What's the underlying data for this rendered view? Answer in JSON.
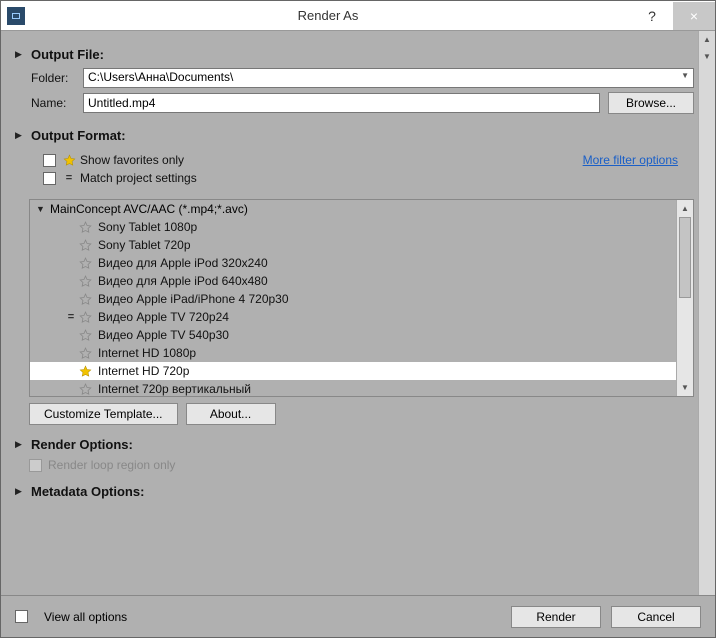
{
  "titlebar": {
    "title": "Render As",
    "help": "?",
    "close": "×"
  },
  "sections": {
    "output_file": "Output File:",
    "output_format": "Output Format:",
    "render_options": "Render Options:",
    "metadata_options": "Metadata Options:"
  },
  "labels": {
    "folder": "Folder:",
    "name": "Name:",
    "browse": "Browse...",
    "show_favorites": "Show favorites only",
    "match_project": "Match project settings",
    "more_filter": "More filter options",
    "customize": "Customize Template...",
    "about": "About...",
    "render_loop": "Render loop region only",
    "view_all": "View all options",
    "render": "Render",
    "cancel": "Cancel"
  },
  "values": {
    "folder": "C:\\Users\\Анна\\Documents\\",
    "name": "Untitled.mp4"
  },
  "format_group": "MainConcept AVC/AAC (*.mp4;*.avc)",
  "formats": [
    {
      "name": "Sony Tablet 1080p",
      "fav": false,
      "eq": false,
      "sel": false
    },
    {
      "name": "Sony Tablet 720p",
      "fav": false,
      "eq": false,
      "sel": false
    },
    {
      "name": "Видео для Apple iPod 320x240",
      "fav": false,
      "eq": false,
      "sel": false
    },
    {
      "name": "Видео для Apple iPod 640x480",
      "fav": false,
      "eq": false,
      "sel": false
    },
    {
      "name": "Видео Apple iPad/iPhone 4 720p30",
      "fav": false,
      "eq": false,
      "sel": false
    },
    {
      "name": "Видео Apple TV 720p24",
      "fav": false,
      "eq": true,
      "sel": false
    },
    {
      "name": "Видео Apple TV 540p30",
      "fav": false,
      "eq": false,
      "sel": false
    },
    {
      "name": "Internet HD 1080p",
      "fav": false,
      "eq": false,
      "sel": false
    },
    {
      "name": "Internet HD 720p",
      "fav": true,
      "eq": false,
      "sel": true
    },
    {
      "name": "Internet 720р вертикальный",
      "fav": false,
      "eq": false,
      "sel": false
    }
  ],
  "colors": {
    "link": "#1a5fc7",
    "bg": "#b0b0b0"
  }
}
